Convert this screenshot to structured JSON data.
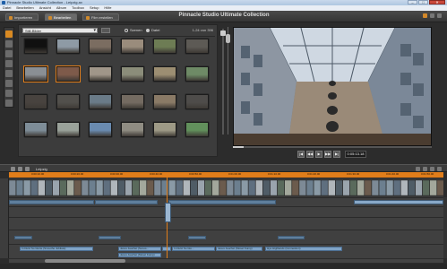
{
  "window": {
    "title": "Pinnacle Studio Ultimate Collection - Leipzig.ax",
    "minimize": "–",
    "maximize": "□",
    "close": "✕"
  },
  "menu": [
    "Datei",
    "Bearbeiten",
    "Ansicht",
    "Album",
    "Toolbox",
    "Setup",
    "Hilfe"
  ],
  "app": {
    "tabs": [
      "Importieren",
      "Bearbeiten",
      "Film erstellen"
    ],
    "active_tab": 1,
    "product_title": "Pinnacle Studio Ultimate Collection"
  },
  "library": {
    "folder": "Still-Bilder",
    "filters": [
      {
        "label": "Szenen",
        "selected": true
      },
      {
        "label": "Datei",
        "selected": false
      }
    ],
    "count_label": "1-24 von 396",
    "thumbnail_colors": [
      "#101010",
      "#8e9aa5",
      "#7b6d61",
      "#9a8c7c",
      "#6d7c54",
      "#5d5a55",
      "#8a8f94",
      "#7e5a4a",
      "#a09689",
      "#8b8d7a",
      "#9c8e72",
      "#6e8a66",
      "#48433f",
      "#52504c",
      "#6a7b88",
      "#746b61",
      "#8a7a66",
      "#4e4c4a",
      "#7e8d98",
      "#9aa29a",
      "#6a8bb0",
      "#8f8c82",
      "#9e9a86",
      "#62905c"
    ]
  },
  "player": {
    "timecode": "0:05:13.18",
    "buttons": [
      "|◀",
      "◀◀",
      "▶",
      "▶▶",
      "▶|"
    ]
  },
  "timeline": {
    "project_name": "Leipzig",
    "ruler_ticks": [
      "0:00:10.00",
      "0:00:20.00",
      "0:00:30.00",
      "0:00:40.00",
      "0:00:50.00",
      "0:01:00.00",
      "0:01:10.00",
      "0:01:20.00",
      "0:01:30.00",
      "0:01:40.00",
      "0:01:50.00"
    ],
    "title_clips": [
      "In Dulci So Glorie (Smoothe Jubilate)",
      "Jesus Jauchet (Sonos...",
      "Jesus Jauchet (Mosel Kump)",
      "In Dulci So Glo...",
      "Jesus Jauchet (Mosel Kump)",
      "Hye Highlands (Connestion)"
    ]
  },
  "colors": {
    "accent": "#e07d1a",
    "clip_blue": "#7fa3c6"
  }
}
